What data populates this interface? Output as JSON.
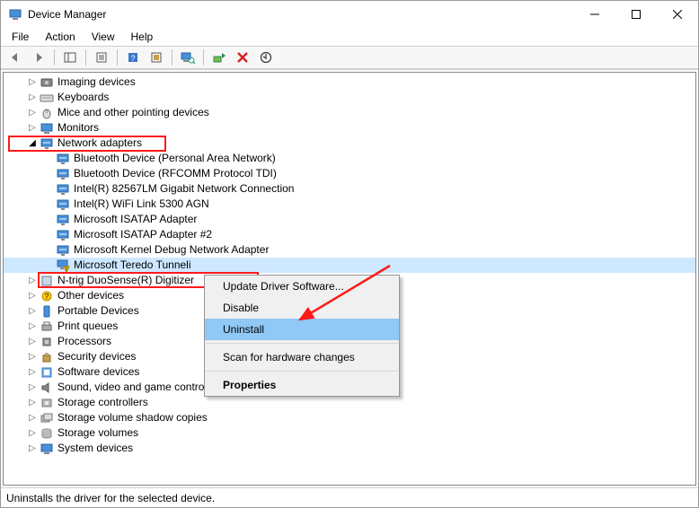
{
  "window": {
    "title": "Device Manager"
  },
  "menubar": [
    "File",
    "Action",
    "View",
    "Help"
  ],
  "tree": [
    {
      "depth": 0,
      "exp": ">",
      "icon": "imaging",
      "label": "Imaging devices"
    },
    {
      "depth": 0,
      "exp": ">",
      "icon": "keyboard",
      "label": "Keyboards"
    },
    {
      "depth": 0,
      "exp": ">",
      "icon": "mouse",
      "label": "Mice and other pointing devices"
    },
    {
      "depth": 0,
      "exp": ">",
      "icon": "monitor",
      "label": "Monitors"
    },
    {
      "depth": 0,
      "exp": "v",
      "icon": "net",
      "label": "Network adapters",
      "hl": true
    },
    {
      "depth": 1,
      "exp": "",
      "icon": "net",
      "label": "Bluetooth Device (Personal Area Network)"
    },
    {
      "depth": 1,
      "exp": "",
      "icon": "net",
      "label": "Bluetooth Device (RFCOMM Protocol TDI)"
    },
    {
      "depth": 1,
      "exp": "",
      "icon": "net",
      "label": "Intel(R) 82567LM Gigabit Network Connection"
    },
    {
      "depth": 1,
      "exp": "",
      "icon": "net",
      "label": "Intel(R) WiFi Link 5300 AGN"
    },
    {
      "depth": 1,
      "exp": "",
      "icon": "net",
      "label": "Microsoft ISATAP Adapter"
    },
    {
      "depth": 1,
      "exp": "",
      "icon": "net",
      "label": "Microsoft ISATAP Adapter #2"
    },
    {
      "depth": 1,
      "exp": "",
      "icon": "net",
      "label": "Microsoft Kernel Debug Network Adapter"
    },
    {
      "depth": 1,
      "exp": "",
      "icon": "net-warn",
      "label": "Microsoft Teredo Tunneling Adapter",
      "hl": true,
      "sel": true,
      "truncate": true
    },
    {
      "depth": 0,
      "exp": ">",
      "icon": "hid",
      "label": "N-trig DuoSense(R) Digitizer"
    },
    {
      "depth": 0,
      "exp": ">",
      "icon": "other",
      "label": "Other devices"
    },
    {
      "depth": 0,
      "exp": ">",
      "icon": "portable",
      "label": "Portable Devices"
    },
    {
      "depth": 0,
      "exp": ">",
      "icon": "printq",
      "label": "Print queues"
    },
    {
      "depth": 0,
      "exp": ">",
      "icon": "cpu",
      "label": "Processors"
    },
    {
      "depth": 0,
      "exp": ">",
      "icon": "security",
      "label": "Security devices"
    },
    {
      "depth": 0,
      "exp": ">",
      "icon": "software",
      "label": "Software devices"
    },
    {
      "depth": 0,
      "exp": ">",
      "icon": "sound",
      "label": "Sound, video and game controllers"
    },
    {
      "depth": 0,
      "exp": ">",
      "icon": "storage",
      "label": "Storage controllers"
    },
    {
      "depth": 0,
      "exp": ">",
      "icon": "shadow",
      "label": "Storage volume shadow copies"
    },
    {
      "depth": 0,
      "exp": ">",
      "icon": "volume",
      "label": "Storage volumes"
    },
    {
      "depth": 0,
      "exp": ">",
      "icon": "system",
      "label": "System devices"
    }
  ],
  "context_menu": {
    "items": [
      {
        "label": "Update Driver Software..."
      },
      {
        "label": "Disable"
      },
      {
        "label": "Uninstall",
        "hover": true,
        "hl": true
      },
      {
        "sep": true
      },
      {
        "label": "Scan for hardware changes"
      },
      {
        "sep": true
      },
      {
        "label": "Properties",
        "bold": true
      }
    ]
  },
  "statusbar": "Uninstalls the driver for the selected device."
}
